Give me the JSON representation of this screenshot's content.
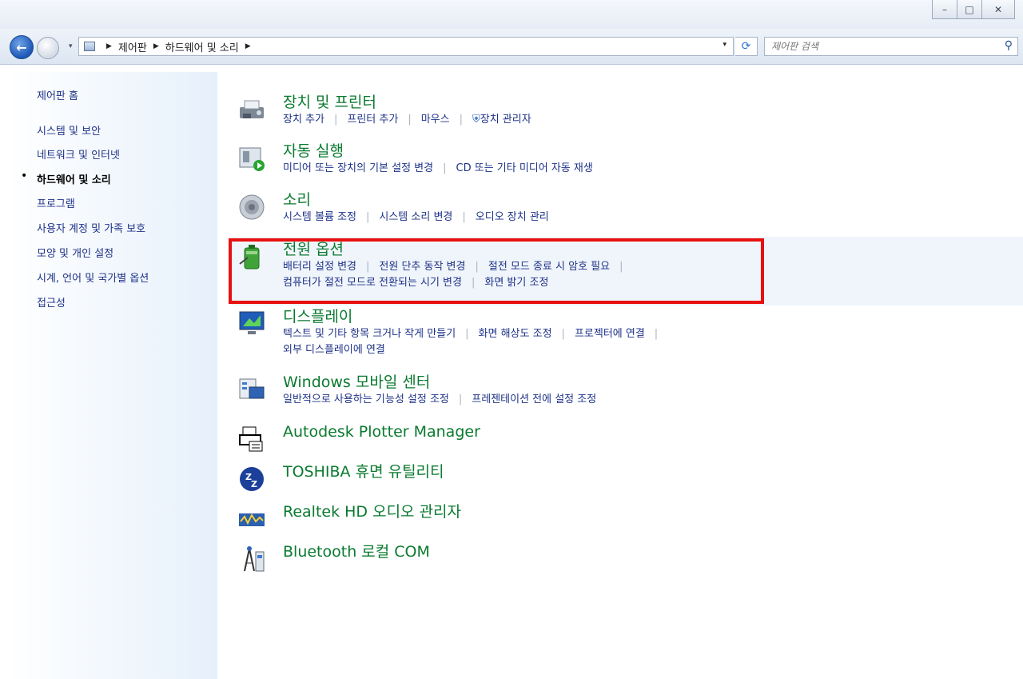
{
  "window": {
    "buttons": {
      "minimize": "–",
      "maximize": "□",
      "close": "✕"
    }
  },
  "nav": {
    "back_icon": "←",
    "dropdown_icon": "▾",
    "breadcrumb": [
      "제어판",
      "하드웨어 및 소리"
    ],
    "separator": "▶",
    "search_placeholder": "제어판 검색",
    "refresh_icon": "⟳",
    "search_icon": "⚲"
  },
  "sidebar": {
    "home": "제어판 홈",
    "items": [
      "시스템 및 보안",
      "네트워크 및 인터넷",
      "하드웨어 및 소리",
      "프로그램",
      "사용자 계정 및 가족 보호",
      "모양 및 개인 설정",
      "시계, 언어 및 국가별 옵션",
      "접근성"
    ],
    "current_index": 2,
    "bullet": "•"
  },
  "categories": [
    {
      "title": "장치 및 프린터",
      "links": [
        "장치 추가",
        "프린터 추가",
        "마우스",
        "장치 관리자"
      ],
      "icon": "printer-icon"
    },
    {
      "title": "자동 실행",
      "links": [
        "미디어 또는 장치의 기본 설정 변경",
        "CD 또는 기타 미디어 자동 재생"
      ],
      "icon": "autoplay-icon"
    },
    {
      "title": "소리",
      "links": [
        "시스템 볼륨 조정",
        "시스템 소리 변경",
        "오디오 장치 관리"
      ],
      "icon": "speaker-icon"
    },
    {
      "title": "전원 옵션",
      "links": [
        "배터리 설정 변경",
        "전원 단추 동작 변경",
        "절전 모드 종료 시 암호 필요",
        "컴퓨터가 절전 모드로 전환되는 시기 변경",
        "화면 밝기 조정"
      ],
      "icon": "battery-icon"
    },
    {
      "title": "디스플레이",
      "links": [
        "텍스트 및 기타 항목 크거나 작게 만들기",
        "화면 해상도 조정",
        "프로젝터에 연결",
        "외부 디스플레이에 연결"
      ],
      "icon": "display-icon"
    },
    {
      "title": "Windows 모바일 센터",
      "links": [
        "일반적으로 사용하는 기능성 설정 조정",
        "프레젠테이션 전에 설정 조정"
      ],
      "icon": "mobility-icon"
    },
    {
      "title": "Autodesk Plotter Manager",
      "links": [],
      "icon": "plotter-icon"
    },
    {
      "title": "TOSHIBA 휴면 유틸리티",
      "links": [],
      "icon": "sleep-icon"
    },
    {
      "title": "Realtek HD 오디오 관리자",
      "links": [],
      "icon": "realtek-icon"
    },
    {
      "title": "Bluetooth 로컬 COM",
      "links": [],
      "icon": "bluetooth-icon"
    }
  ],
  "colors": {
    "link": "#1e3287",
    "title": "#0a7a2f",
    "highlight": "#e8100f"
  }
}
